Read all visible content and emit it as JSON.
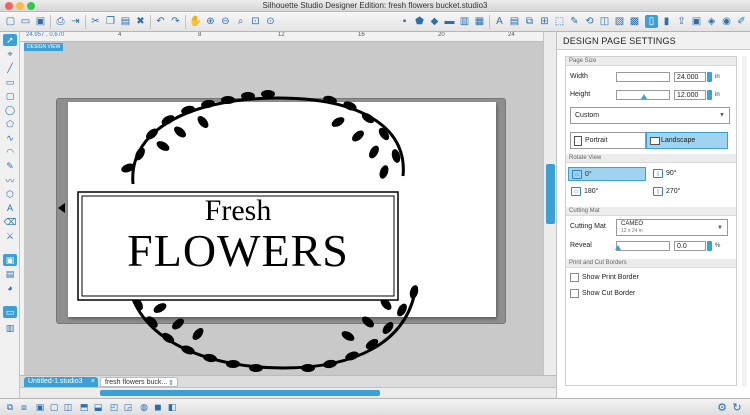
{
  "window": {
    "title": "Silhouette Studio Designer Edition: fresh flowers bucket.studio3",
    "traffic_colors": [
      "#fc605c",
      "#fdbc40",
      "#34c84a"
    ]
  },
  "toolbar": {
    "left_icons": [
      "new-file-icon",
      "open-folder-icon",
      "save-icon",
      "print-icon",
      "send-to-silhouette-icon",
      "cut-icon",
      "copy-icon",
      "paste-icon",
      "duplicate-icon",
      "delete-icon",
      "undo-icon",
      "redo-icon",
      "pan-icon",
      "zoom-in-icon",
      "zoom-out-icon",
      "zoom-select-icon",
      "fit-page-icon",
      "magnify-icon"
    ],
    "right_icons": [
      "shape-icon",
      "pentagon-icon",
      "fill-icon",
      "line-icon",
      "gradient-icon",
      "pattern-icon",
      "text-style-icon",
      "align-icon",
      "replicate-icon",
      "modify-icon",
      "offset-icon",
      "trace-icon",
      "page-settings-icon",
      "cut-settings-icon",
      "send-icon",
      "library-icon",
      "store-icon"
    ]
  },
  "left_tools": [
    "select-icon",
    "edit-points-icon",
    "line-tool-icon",
    "rectangle-tool-icon",
    "rounded-rect-icon",
    "ellipse-tool-icon",
    "polygon-icon",
    "curve-icon",
    "arc-icon",
    "freehand-icon",
    "smooth-freehand-icon",
    "polygon-shape-icon",
    "text-tool-icon",
    "eraser-icon",
    "knife-icon",
    "draw-mode-icon",
    "library-view-icon",
    "store-view-icon",
    "design-page-icon",
    "panel-icon"
  ],
  "ruler": {
    "coords": "24.957 , 0.670",
    "ticks": [
      "4",
      "8",
      "12",
      "16",
      "20",
      "24"
    ]
  },
  "canvas": {
    "view_label": "DESIGN VIEW",
    "design": {
      "word1": "Fresh",
      "word2": "FLOWERS"
    }
  },
  "tabs": [
    {
      "label": "Untitled-1.studio3",
      "close": "×"
    },
    {
      "label": "fresh flowers buck...",
      "close": "⇕"
    }
  ],
  "panel": {
    "title": "DESIGN PAGE SETTINGS",
    "page_size": {
      "section": "Page Size",
      "width_label": "Width",
      "width_value": "24.000",
      "height_label": "Height",
      "height_value": "12.000",
      "unit": "in",
      "preset": "Custom",
      "portrait_label": "Portrait",
      "landscape_label": "Landscape",
      "selected_orientation": "Landscape"
    },
    "rotate_view": {
      "section": "Rotate View",
      "options": [
        "0°",
        "90°",
        "180°",
        "270°"
      ],
      "selected": "0°"
    },
    "cutting_mat": {
      "section": "Cutting Mat",
      "label": "Cutting Mat",
      "value": "CAMEO",
      "sub": "12 x 24 in",
      "reveal_label": "Reveal",
      "reveal_value": "0.0",
      "reveal_unit": "%"
    },
    "borders": {
      "section": "Print and Cut Borders",
      "print_border": "Show Print Border",
      "cut_border": "Show Cut Border",
      "print_border_checked": false,
      "cut_border_checked": false
    }
  },
  "bottom_icons": [
    "group-icon",
    "ungroup-icon",
    "compound-icon",
    "release-compound-icon",
    "weld-icon",
    "bring-front-icon",
    "send-back-icon",
    "bring-forward-icon",
    "send-backward-icon",
    "lock-icon",
    "settings-icon",
    "refresh-icon"
  ]
}
